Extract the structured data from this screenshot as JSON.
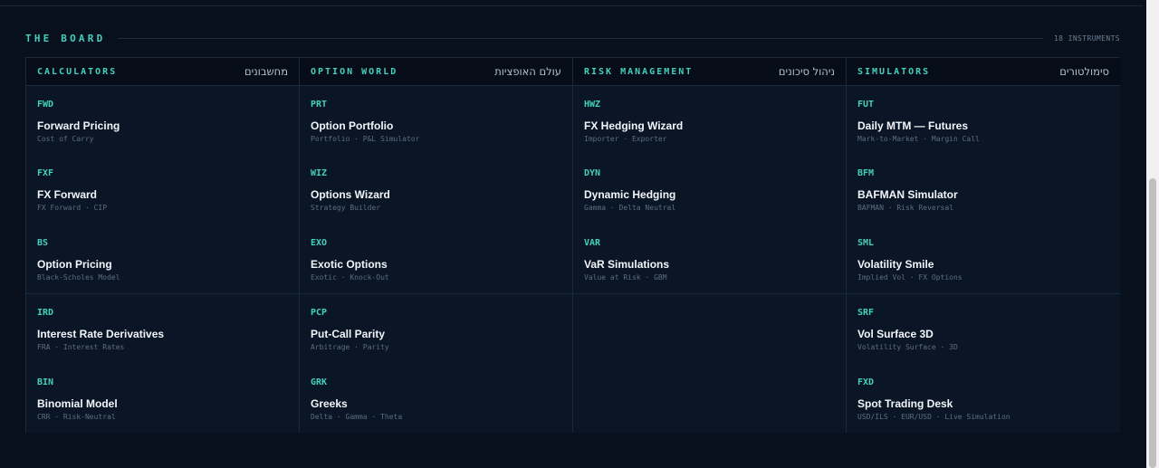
{
  "section": {
    "title": "THE BOARD",
    "count": "18 INSTRUMENTS"
  },
  "columns": [
    {
      "title": "CALCULATORS",
      "title_he": "מחשבונים",
      "items": [
        {
          "code": "FWD",
          "name": "Forward Pricing",
          "sub": "Cost of Carry"
        },
        {
          "code": "FXF",
          "name": "FX Forward",
          "sub": "FX Forward · CIP"
        },
        {
          "code": "BS",
          "name": "Option Pricing",
          "sub": "Black-Scholes Model"
        },
        {
          "code": "IRD",
          "name": "Interest Rate Derivatives",
          "sub": "FRA · Interest Rates"
        },
        {
          "code": "BIN",
          "name": "Binomial Model",
          "sub": "CRR · Risk-Neutral"
        }
      ]
    },
    {
      "title": "OPTION WORLD",
      "title_he": "עולם האופציות",
      "items": [
        {
          "code": "PRT",
          "name": "Option Portfolio",
          "sub": "Portfolio · P&L Simulator"
        },
        {
          "code": "WIZ",
          "name": "Options Wizard",
          "sub": "Strategy Builder"
        },
        {
          "code": "EXO",
          "name": "Exotic Options",
          "sub": "Exotic · Knock-Out"
        },
        {
          "code": "PCP",
          "name": "Put-Call Parity",
          "sub": "Arbitrage · Parity"
        },
        {
          "code": "GRK",
          "name": "Greeks",
          "sub": "Delta · Gamma · Theta"
        }
      ]
    },
    {
      "title": "RISK MANAGEMENT",
      "title_he": "ניהול סיכונים",
      "items": [
        {
          "code": "HWZ",
          "name": "FX Hedging Wizard",
          "sub": "Importer · Exporter"
        },
        {
          "code": "DYN",
          "name": "Dynamic Hedging",
          "sub": "Gamma · Delta Neutral"
        },
        {
          "code": "VAR",
          "name": "VaR Simulations",
          "sub": "Value at Risk · GBM"
        }
      ]
    },
    {
      "title": "SIMULATORS",
      "title_he": "סימולטורים",
      "items": [
        {
          "code": "FUT",
          "name": "Daily MTM — Futures",
          "sub": "Mark-to-Market · Margin Call"
        },
        {
          "code": "BFM",
          "name": "BAFMAN Simulator",
          "sub": "BAFMAN · Risk Reversal"
        },
        {
          "code": "SML",
          "name": "Volatility Smile",
          "sub": "Implied Vol · FX Options"
        },
        {
          "code": "SRF",
          "name": "Vol Surface 3D",
          "sub": "Volatility Surface · 3D"
        },
        {
          "code": "FXD",
          "name": "Spot Trading Desk",
          "sub": "USD/ILS · EUR/USD · Live Simulation"
        }
      ]
    }
  ]
}
